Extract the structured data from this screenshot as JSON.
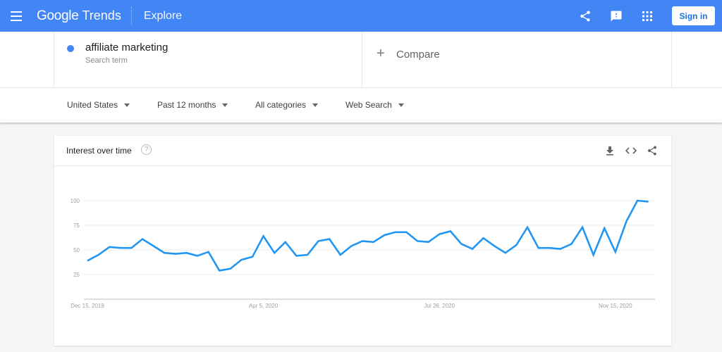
{
  "header": {
    "brand_google": "Google",
    "brand_trends": "Trends",
    "section": "Explore",
    "icons": [
      "menu-icon",
      "share-icon",
      "feedback-icon",
      "apps-icon"
    ],
    "sign_in": "Sign in"
  },
  "search": {
    "term": "affiliate marketing",
    "term_type": "Search term",
    "term_color": "#4285f4",
    "compare_label": "Compare"
  },
  "filters": {
    "region": "United States",
    "time_range": "Past 12 months",
    "category": "All categories",
    "property": "Web Search"
  },
  "card": {
    "title": "Interest over time",
    "help": "?",
    "actions": [
      "download-icon",
      "embed-icon",
      "share-icon"
    ]
  },
  "chart_data": {
    "type": "line",
    "title": "Interest over time",
    "xlabel": "",
    "ylabel": "",
    "ylim": [
      0,
      100
    ],
    "yticks": [
      25,
      50,
      75,
      100
    ],
    "xtick_labels": [
      {
        "label": "Dec 15, 2019",
        "index": 0
      },
      {
        "label": "Apr 5, 2020",
        "index": 16
      },
      {
        "label": "Jul 26, 2020",
        "index": 32
      },
      {
        "label": "Nov 15, 2020",
        "index": 48
      }
    ],
    "grid": true,
    "legend": "none",
    "series": [
      {
        "name": "affiliate marketing",
        "color": "#2196f3",
        "values": [
          39,
          45,
          53,
          52,
          52,
          61,
          54,
          47,
          46,
          47,
          44,
          48,
          29,
          31,
          40,
          43,
          64,
          47,
          58,
          44,
          45,
          59,
          61,
          45,
          54,
          59,
          58,
          65,
          68,
          68,
          59,
          58,
          66,
          69,
          56,
          51,
          62,
          54,
          47,
          55,
          73,
          52,
          52,
          51,
          56,
          73,
          45,
          72,
          48,
          79,
          100,
          99
        ]
      }
    ]
  }
}
